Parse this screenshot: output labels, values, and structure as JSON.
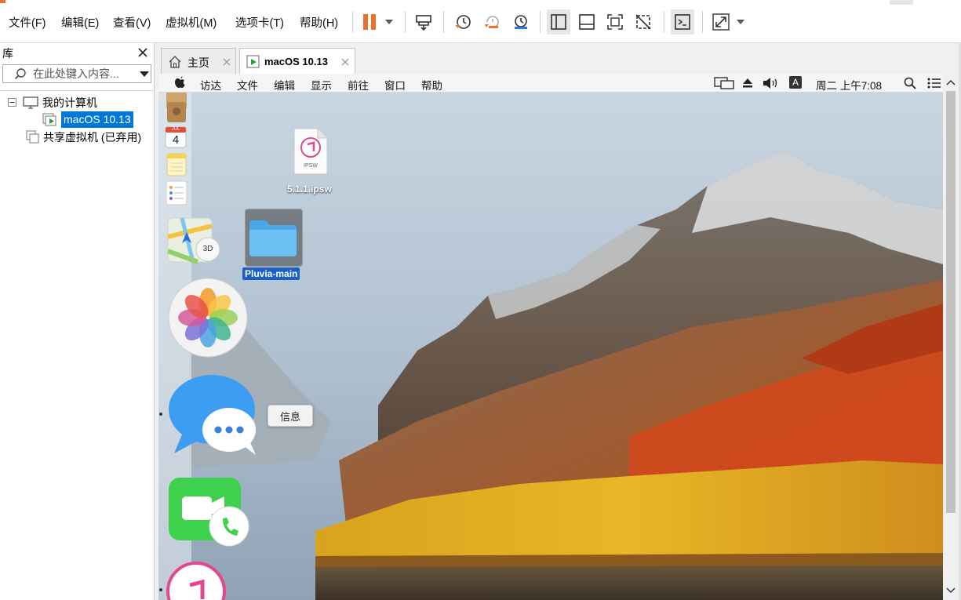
{
  "app": {
    "accent": "#e8712b"
  },
  "menu": [
    "文件(F)",
    "编辑(E)",
    "查看(V)",
    "虚拟机(M)",
    "选项卡(T)",
    "帮助(H)"
  ],
  "toolbar": {
    "icons": [
      "pause-icon",
      "dropdown-arrow-icon",
      "send-ctrl-alt-del-icon",
      "snapshot-take-icon",
      "snapshot-revert-icon",
      "snapshot-manager-icon",
      "library-view-icon",
      "thumbnail-bar-icon",
      "fullscreen-icon",
      "unity-icon",
      "console-view-icon",
      "stretch-guest-icon",
      "stretch-dropdown-icon"
    ]
  },
  "library": {
    "title": "库",
    "search_placeholder": "在此处键入内容...",
    "tree": {
      "my_computer": "我的计算机",
      "vm": "macOS 10.13",
      "shared": "共享虚拟机 (已弃用)"
    }
  },
  "tabs": [
    {
      "label": "主页",
      "active": false
    },
    {
      "label": "macOS 10.13",
      "active": true
    }
  ],
  "mac": {
    "menu": [
      "访达",
      "文件",
      "编辑",
      "显示",
      "前往",
      "窗口",
      "帮助"
    ],
    "input_source": "A",
    "clock": "周二 上午7:08",
    "desktop_items": [
      {
        "name": "5.1.1.ipsw",
        "file_badge": "IPSW"
      },
      {
        "name": "Pluvia-main"
      }
    ],
    "maps_badge": "3D",
    "calendar": {
      "month": "JUL",
      "day": "4"
    },
    "tooltip": "信息"
  }
}
